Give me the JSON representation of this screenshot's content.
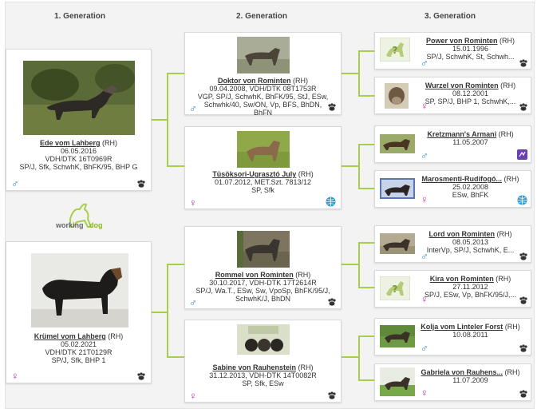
{
  "generations": [
    "1. Generation",
    "2. Generation",
    "3. Generation"
  ],
  "logo": {
    "text1": "working",
    "text2": "dog"
  },
  "gen1": [
    {
      "name": "Ede vom Lahberg",
      "tag": "(RH)",
      "lines": [
        "06.05.2016",
        "VDH/DTK 16T0969R",
        "SP/J, Sfk, SchwhK, BhFK/95, BHP G"
      ],
      "sex": "♂"
    },
    {
      "name": "Krümel vom Lahberg",
      "tag": "(RH)",
      "lines": [
        "05.02.2021",
        "VDH/DTK 21T0129R",
        "SP/J, Sfk, BHP 1"
      ],
      "sex": "♀"
    }
  ],
  "gen2": [
    {
      "name": "Doktor von Rominten",
      "tag": "(RH)",
      "lines": [
        "09.04.2008, VDH/DTK 08T1753R",
        "VGP, SP/J, SchwhK, BhFK/95, StJ, ESw,",
        "Schwhk/40, Sw/ON, Vp, BFS, BhDN,",
        "BhFN"
      ],
      "sex": "♂"
    },
    {
      "name": "Tüsöksori-Ugrasztó July",
      "tag": "(RH)",
      "lines": [
        "01.07.2012, MET.Szt. 7813/12",
        "SP, Sfk"
      ],
      "sex": "♀"
    },
    {
      "name": "Rommel von Rominten",
      "tag": "(RH)",
      "lines": [
        "30.10.2017, VDH-DTK 17T2614R",
        "SP/J, Wa.T., ESw, Sw, VpoSp, BhFK/95/J,",
        "SchwhK/J, BhDN"
      ],
      "sex": "♂"
    },
    {
      "name": "Sabine von Rauhenstein",
      "tag": "(RH)",
      "lines": [
        "31.12.2013, VDH-DTK 14T0082R",
        "SP, Sfk, ESw"
      ],
      "sex": "♀"
    }
  ],
  "gen3": [
    {
      "name": "Power von Rominten",
      "tag": "(RH)",
      "lines": [
        "15.01.1996",
        "SP/J, SchwhK, St, Schwh..."
      ],
      "sex": "♂"
    },
    {
      "name": "Wurzel von Rominten",
      "tag": "(RH)",
      "lines": [
        "08.12.2001",
        "SP, SP/J, BHP 1, SchwhK,..."
      ],
      "sex": "♀"
    },
    {
      "name": "Kretzmann's Armani",
      "tag": "(RH)",
      "lines": [
        "11.05.2007"
      ],
      "sex": "♂"
    },
    {
      "name": "Marosmenti-Rudifogó...",
      "tag": "(RH)",
      "lines": [
        "25.02.2008",
        "ESw, BhFK"
      ],
      "sex": "♀"
    },
    {
      "name": "Lord von Rominten",
      "tag": "(RH)",
      "lines": [
        "08.05.2013",
        "InterVp, SP/J, SchwhK, E..."
      ],
      "sex": "♂"
    },
    {
      "name": "Kira von Rominten",
      "tag": "(RH)",
      "lines": [
        "27.11.2012",
        "SP/J, ESw, Vp, BhFK/95/J,..."
      ],
      "sex": "♀"
    },
    {
      "name": "Kolja vom Linteler Forst",
      "tag": "(RH)",
      "lines": [
        "10.08.2011"
      ],
      "sex": "♂"
    },
    {
      "name": "Gabriela von Rauhens...",
      "tag": "(RH)",
      "lines": [
        "11.07.2009"
      ],
      "sex": "♀"
    }
  ],
  "colors": {
    "connector": "#a8cf4c",
    "male": "#1f7fc4",
    "female": "#b62fb2"
  }
}
